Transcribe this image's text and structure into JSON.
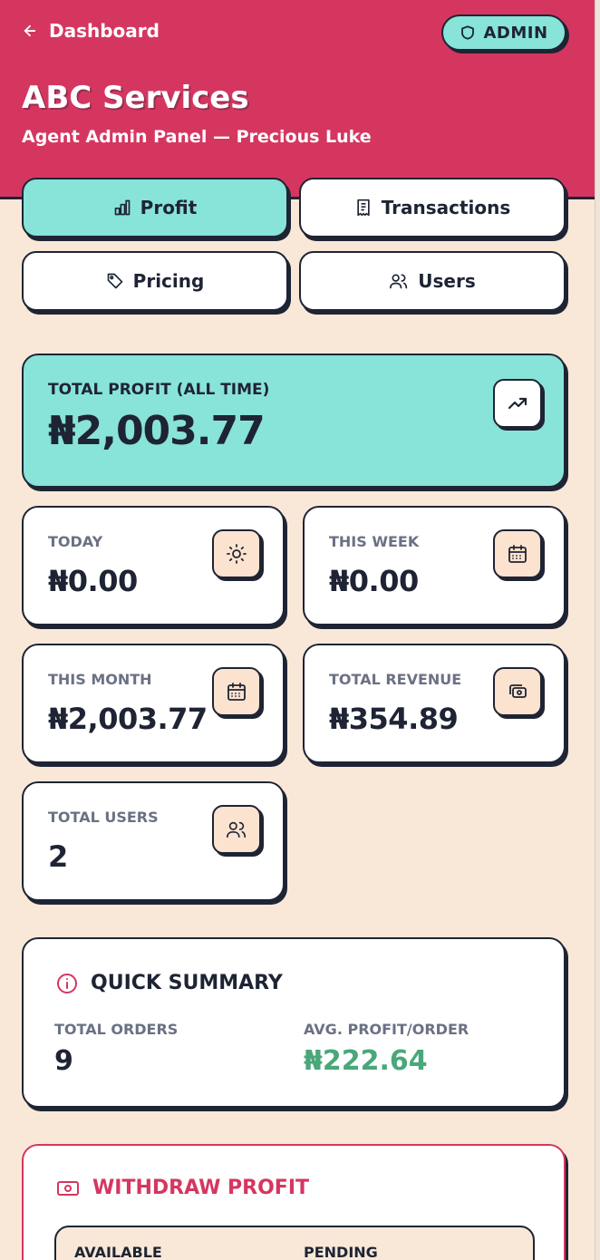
{
  "header": {
    "back_label": "Dashboard",
    "badge_label": "ADMIN",
    "title": "ABC Services",
    "subtitle": "Agent Admin Panel — Precious Luke",
    "background_color": "#d53660"
  },
  "tabs": [
    {
      "label": "Profit",
      "icon": "bar-chart-icon",
      "active": true
    },
    {
      "label": "Transactions",
      "icon": "receipt-icon",
      "active": false
    },
    {
      "label": "Pricing",
      "icon": "tag-icon",
      "active": false
    },
    {
      "label": "Users",
      "icon": "users-icon",
      "active": false
    }
  ],
  "total_profit": {
    "label": "TOTAL PROFIT (ALL TIME)",
    "value": "₦2,003.77",
    "icon": "trending-up-icon"
  },
  "stats": [
    {
      "label": "TODAY",
      "value": "₦0.00",
      "icon": "sun-icon"
    },
    {
      "label": "THIS WEEK",
      "value": "₦0.00",
      "icon": "calendar-icon"
    },
    {
      "label": "THIS MONTH",
      "value": "₦2,003.77",
      "icon": "calendar-icon"
    },
    {
      "label": "TOTAL REVENUE",
      "value": "₦354.89",
      "icon": "banknote-icon"
    },
    {
      "label": "TOTAL USERS",
      "value": "2",
      "icon": "users-icon"
    }
  ],
  "quick_summary": {
    "heading": "QUICK SUMMARY",
    "icon": "info-icon",
    "total_orders_label": "TOTAL ORDERS",
    "total_orders_value": "9",
    "avg_profit_label": "AVG. PROFIT/ORDER",
    "avg_profit_value": "₦222.64",
    "avg_profit_color": "#4aa77a"
  },
  "withdraw": {
    "heading": "WITHDRAW PROFIT",
    "icon": "banknote-icon",
    "available_label": "AVAILABLE",
    "pending_label": "PENDING",
    "accent_color": "#d53660"
  },
  "colors": {
    "page_background": "#f9e8d8",
    "accent_teal": "#88e3d8",
    "ink": "#1e2434",
    "muted": "#6b7184"
  }
}
